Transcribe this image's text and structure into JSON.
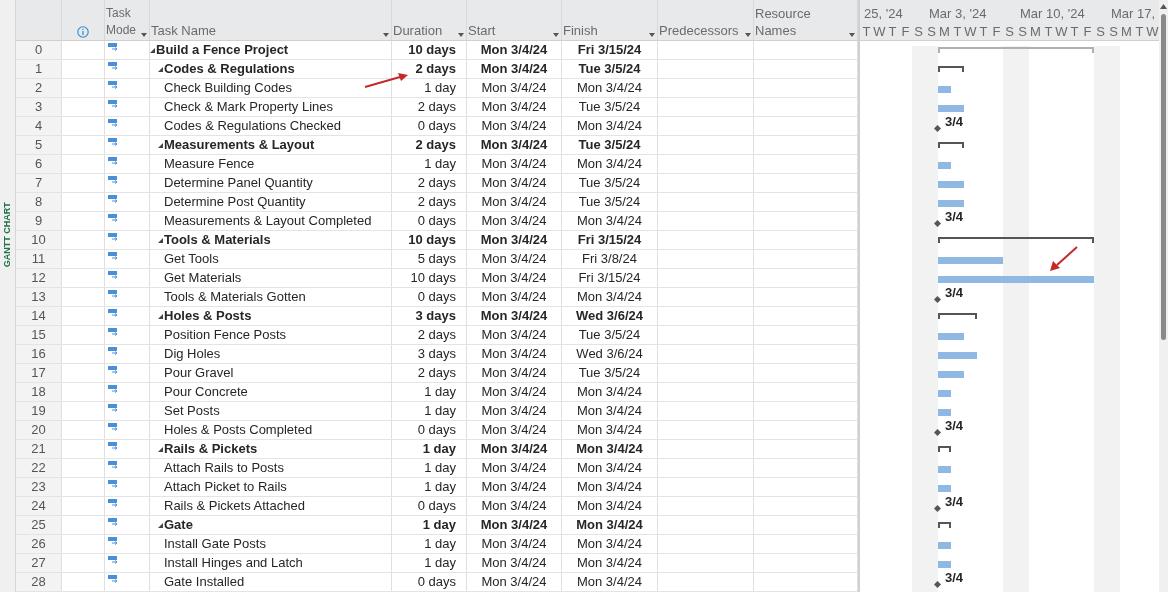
{
  "side_label": "GANTT CHART",
  "columns": [
    {
      "kind": "id"
    },
    {
      "kind": "info"
    },
    {
      "kind": "mode",
      "label": "Task Mode"
    },
    {
      "kind": "name",
      "label": "Task Name"
    },
    {
      "kind": "duration",
      "label": "Duration"
    },
    {
      "kind": "start",
      "label": "Start"
    },
    {
      "kind": "finish",
      "label": "Finish"
    },
    {
      "kind": "pred",
      "label": "Predecessors"
    },
    {
      "kind": "res",
      "label": "Resource Names"
    }
  ],
  "timescale": {
    "weeks": [
      {
        "label": "25, '24"
      },
      {
        "label": "Mar 3, '24"
      },
      {
        "label": "Mar 10, '24"
      },
      {
        "label": "Mar 17,"
      }
    ],
    "days": [
      {
        "label": "T",
        "weekend": false
      },
      {
        "label": "W",
        "weekend": false
      },
      {
        "label": "T",
        "weekend": false
      },
      {
        "label": "F",
        "weekend": false
      },
      {
        "label": "S",
        "weekend": true
      },
      {
        "label": "S",
        "weekend": true
      },
      {
        "label": "M",
        "weekend": false
      },
      {
        "label": "T",
        "weekend": false
      },
      {
        "label": "W",
        "weekend": false
      },
      {
        "label": "T",
        "weekend": false
      },
      {
        "label": "F",
        "weekend": false
      },
      {
        "label": "S",
        "weekend": true
      },
      {
        "label": "S",
        "weekend": true
      },
      {
        "label": "M",
        "weekend": false
      },
      {
        "label": "T",
        "weekend": false
      },
      {
        "label": "W",
        "weekend": false
      },
      {
        "label": "T",
        "weekend": false
      },
      {
        "label": "F",
        "weekend": false
      },
      {
        "label": "S",
        "weekend": true
      },
      {
        "label": "S",
        "weekend": true
      },
      {
        "label": "M",
        "weekend": false
      },
      {
        "label": "T",
        "weekend": false
      },
      {
        "label": "W",
        "weekend": false
      }
    ]
  },
  "tasks": [
    {
      "id": "0",
      "name": "Build a Fence Project",
      "duration": "10 days",
      "start": "Mon 3/4/24",
      "finish": "Fri 3/15/24",
      "kind": "project",
      "expanded": true,
      "children": [
        {
          "id": "1",
          "name": "Codes & Regulations",
          "duration": "2 days",
          "start": "Mon 3/4/24",
          "finish": "Tue 3/5/24",
          "kind": "summary",
          "expanded": true,
          "children": [
            {
              "id": "2",
              "name": "Check Building Codes",
              "duration": "1 day",
              "start": "Mon 3/4/24",
              "finish": "Mon 3/4/24",
              "kind": "task"
            },
            {
              "id": "3",
              "name": "Check & Mark Property Lines",
              "duration": "2 days",
              "start": "Mon 3/4/24",
              "finish": "Tue 3/5/24",
              "kind": "task"
            },
            {
              "id": "4",
              "name": "Codes & Regulations Checked",
              "duration": "0 days",
              "start": "Mon 3/4/24",
              "finish": "Mon 3/4/24",
              "kind": "milestone",
              "bar_label": "3/4"
            }
          ]
        },
        {
          "id": "5",
          "name": "Measurements & Layout",
          "duration": "2 days",
          "start": "Mon 3/4/24",
          "finish": "Tue 3/5/24",
          "kind": "summary",
          "expanded": true,
          "children": [
            {
              "id": "6",
              "name": "Measure Fence",
              "duration": "1 day",
              "start": "Mon 3/4/24",
              "finish": "Mon 3/4/24",
              "kind": "task"
            },
            {
              "id": "7",
              "name": "Determine Panel Quantity",
              "duration": "2 days",
              "start": "Mon 3/4/24",
              "finish": "Tue 3/5/24",
              "kind": "task"
            },
            {
              "id": "8",
              "name": "Determine Post Quantity",
              "duration": "2 days",
              "start": "Mon 3/4/24",
              "finish": "Tue 3/5/24",
              "kind": "task"
            },
            {
              "id": "9",
              "name": "Measurements & Layout Completed",
              "duration": "0 days",
              "start": "Mon 3/4/24",
              "finish": "Mon 3/4/24",
              "kind": "milestone",
              "bar_label": "3/4"
            }
          ]
        },
        {
          "id": "10",
          "name": "Tools & Materials",
          "duration": "10 days",
          "start": "Mon 3/4/24",
          "finish": "Fri 3/15/24",
          "kind": "summary",
          "expanded": true,
          "children": [
            {
              "id": "11",
              "name": "Get Tools",
              "duration": "5 days",
              "start": "Mon 3/4/24",
              "finish": "Fri 3/8/24",
              "kind": "task"
            },
            {
              "id": "12",
              "name": "Get Materials",
              "duration": "10 days",
              "start": "Mon 3/4/24",
              "finish": "Fri 3/15/24",
              "kind": "task"
            },
            {
              "id": "13",
              "name": "Tools & Materials Gotten",
              "duration": "0 days",
              "start": "Mon 3/4/24",
              "finish": "Mon 3/4/24",
              "kind": "milestone",
              "bar_label": "3/4"
            }
          ]
        },
        {
          "id": "14",
          "name": "Holes & Posts",
          "duration": "3 days",
          "start": "Mon 3/4/24",
          "finish": "Wed 3/6/24",
          "kind": "summary",
          "expanded": true,
          "children": [
            {
              "id": "15",
              "name": "Position Fence Posts",
              "duration": "2 days",
              "start": "Mon 3/4/24",
              "finish": "Tue 3/5/24",
              "kind": "task"
            },
            {
              "id": "16",
              "name": "Dig Holes",
              "duration": "3 days",
              "start": "Mon 3/4/24",
              "finish": "Wed 3/6/24",
              "kind": "task"
            },
            {
              "id": "17",
              "name": "Pour Gravel",
              "duration": "2 days",
              "start": "Mon 3/4/24",
              "finish": "Tue 3/5/24",
              "kind": "task"
            },
            {
              "id": "18",
              "name": "Pour Concrete",
              "duration": "1 day",
              "start": "Mon 3/4/24",
              "finish": "Mon 3/4/24",
              "kind": "task"
            },
            {
              "id": "19",
              "name": "Set Posts",
              "duration": "1 day",
              "start": "Mon 3/4/24",
              "finish": "Mon 3/4/24",
              "kind": "task"
            },
            {
              "id": "20",
              "name": "Holes & Posts Completed",
              "duration": "0 days",
              "start": "Mon 3/4/24",
              "finish": "Mon 3/4/24",
              "kind": "milestone",
              "bar_label": "3/4"
            }
          ]
        },
        {
          "id": "21",
          "name": "Rails & Pickets",
          "duration": "1 day",
          "start": "Mon 3/4/24",
          "finish": "Mon 3/4/24",
          "kind": "summary",
          "expanded": true,
          "children": [
            {
              "id": "22",
              "name": "Attach Rails to Posts",
              "duration": "1 day",
              "start": "Mon 3/4/24",
              "finish": "Mon 3/4/24",
              "kind": "task"
            },
            {
              "id": "23",
              "name": "Attach Picket to Rails",
              "duration": "1 day",
              "start": "Mon 3/4/24",
              "finish": "Mon 3/4/24",
              "kind": "task"
            },
            {
              "id": "24",
              "name": "Rails & Pickets Attached",
              "duration": "0 days",
              "start": "Mon 3/4/24",
              "finish": "Mon 3/4/24",
              "kind": "milestone",
              "bar_label": "3/4"
            }
          ]
        },
        {
          "id": "25",
          "name": "Gate",
          "duration": "1 day",
          "start": "Mon 3/4/24",
          "finish": "Mon 3/4/24",
          "kind": "summary",
          "expanded": true,
          "children": [
            {
              "id": "26",
              "name": "Install Gate Posts",
              "duration": "1 day",
              "start": "Mon 3/4/24",
              "finish": "Mon 3/4/24",
              "kind": "task"
            },
            {
              "id": "27",
              "name": "Install Hinges and Latch",
              "duration": "1 day",
              "start": "Mon 3/4/24",
              "finish": "Mon 3/4/24",
              "kind": "task"
            },
            {
              "id": "28",
              "name": "Gate Installed",
              "duration": "0 days",
              "start": "Mon 3/4/24",
              "finish": "Mon 3/4/24",
              "kind": "milestone",
              "bar_label": "3/4"
            }
          ]
        }
      ]
    }
  ]
}
